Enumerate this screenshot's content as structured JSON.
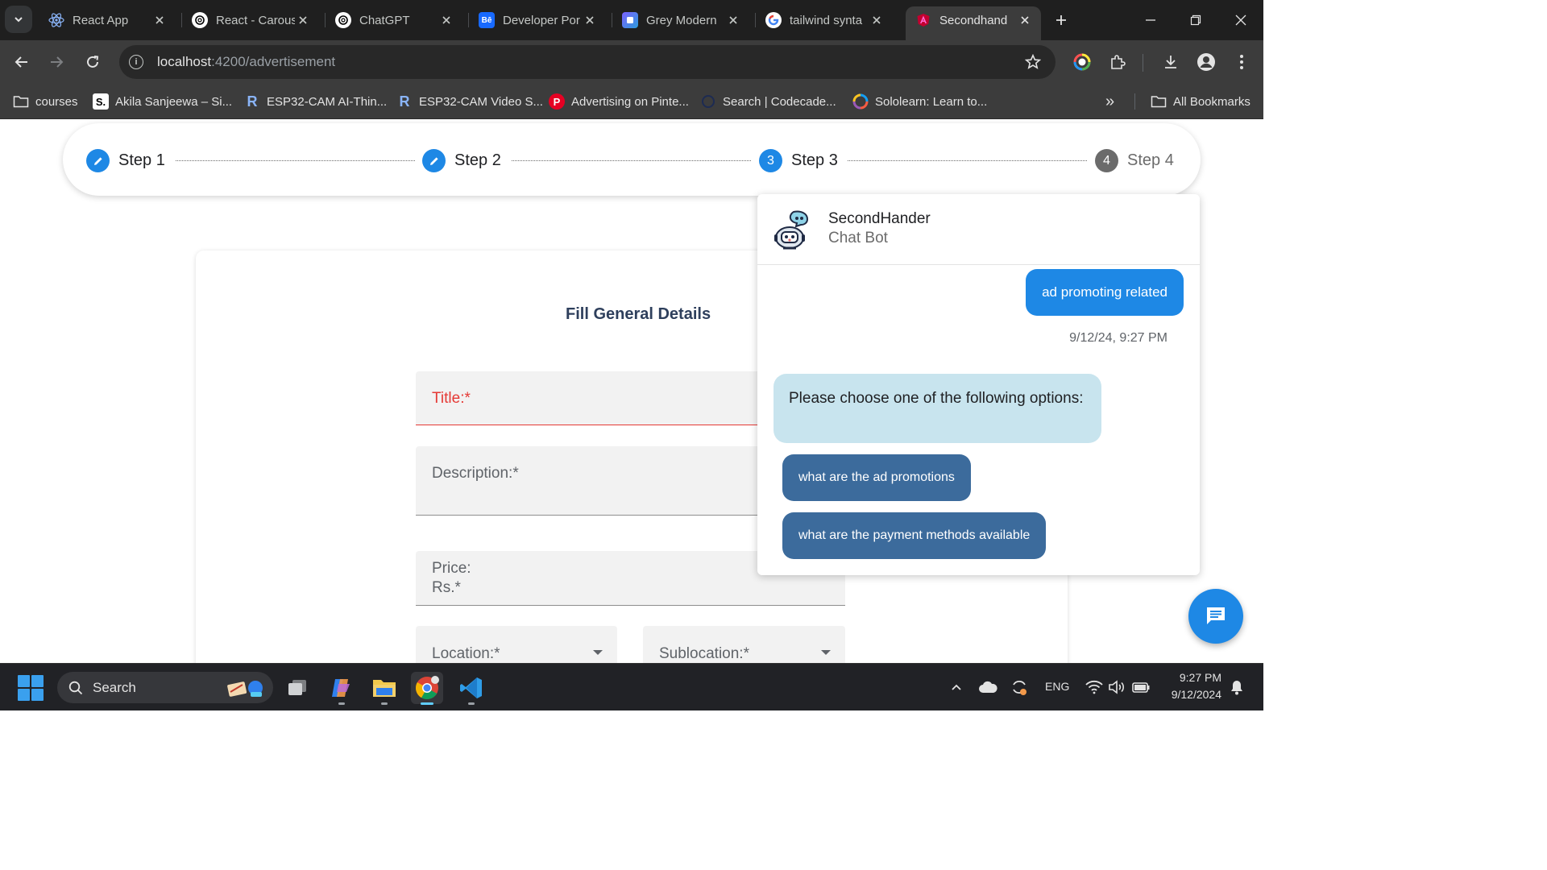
{
  "browser": {
    "tabs": [
      {
        "title": "React App",
        "icon": "react-icon"
      },
      {
        "title": "React - Carous",
        "icon": "chatgpt-icon"
      },
      {
        "title": "ChatGPT",
        "icon": "chatgpt-icon"
      },
      {
        "title": "Developer Por",
        "icon": "behance-icon",
        "icon_text": "Bē"
      },
      {
        "title": "Grey Modern",
        "icon": "canva-icon"
      },
      {
        "title": "tailwind synta",
        "icon": "google-icon"
      },
      {
        "title": "Secondhand",
        "icon": "angular-icon",
        "active": true
      }
    ],
    "url": {
      "host": "localhost",
      "path": ":4200/advertisement"
    },
    "bookmarks": [
      {
        "label": "courses",
        "icon": "folder-icon"
      },
      {
        "label": "Akila Sanjeewa – Si...",
        "icon": "s-icon",
        "icon_text": "S."
      },
      {
        "label": "ESP32-CAM AI-Thin...",
        "icon": "r-icon",
        "icon_text": "R"
      },
      {
        "label": "ESP32-CAM Video S...",
        "icon": "r-icon",
        "icon_text": "R"
      },
      {
        "label": "Advertising on Pinte...",
        "icon": "pinterest-icon",
        "icon_text": "P"
      },
      {
        "label": "Search | Codecade...",
        "icon": "codecademy-icon"
      },
      {
        "label": "Sololearn: Learn to...",
        "icon": "sololearn-icon"
      }
    ],
    "all_bookmarks_label": "All Bookmarks",
    "overflow_label": "»"
  },
  "stepper": {
    "steps": [
      {
        "label": "Step 1",
        "state": "edit"
      },
      {
        "label": "Step 2",
        "state": "edit"
      },
      {
        "label": "Step 3",
        "number": "3",
        "state": "active"
      },
      {
        "label": "Step 4",
        "number": "4",
        "state": "inactive"
      }
    ]
  },
  "form": {
    "title": "Fill General Details",
    "fields": {
      "title_label": "Title:*",
      "description_label": "Description:*",
      "price_label_line1": "Price:",
      "price_label_line2": "Rs.*",
      "location_label": "Location:*",
      "sublocation_label": "Sublocation:*"
    }
  },
  "chat": {
    "bot_name": "SecondHander",
    "bot_role": "Chat Bot",
    "user_message": "ad promoting related",
    "timestamp": "9/12/24, 9:27 PM",
    "bot_message": "Please choose one of the following options:",
    "options": [
      "what are the ad promotions",
      "what are the payment methods available"
    ]
  },
  "taskbar": {
    "search_placeholder": "Search",
    "language": "ENG",
    "time": "9:27 PM",
    "date": "9/12/2024"
  },
  "colors": {
    "accent_blue": "#1e88e5",
    "option_button": "#3c6b9c",
    "bot_bubble": "#c8e4ee",
    "error_red": "#e53935",
    "form_title": "#2e3f5c"
  }
}
